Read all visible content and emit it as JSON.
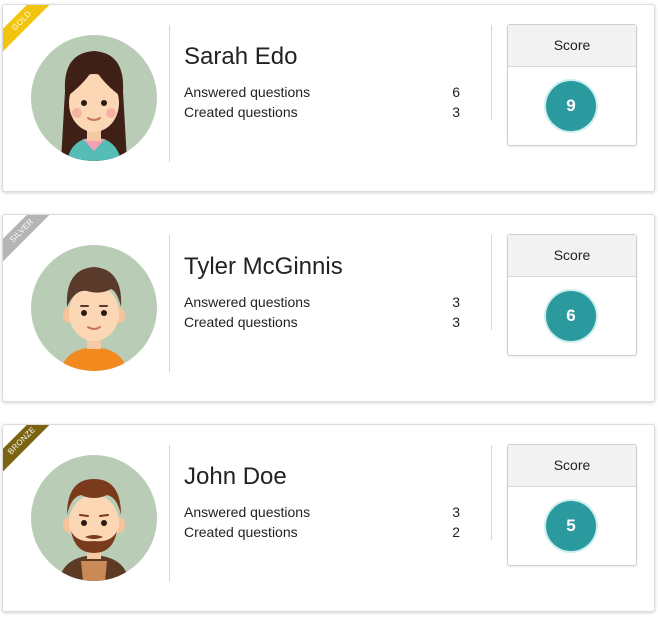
{
  "leaderboard": [
    {
      "rank_badge": "GOLD",
      "badge_color": "#f1c40f",
      "avatar_icon": "avatar-girl-icon",
      "name": "Sarah Edo",
      "answered_label": "Answered questions",
      "answered_value": "6",
      "created_label": "Created questions",
      "created_value": "3",
      "score_label": "Score",
      "score": "9"
    },
    {
      "rank_badge": "SILVER",
      "badge_color": "#b5b5b5",
      "avatar_icon": "avatar-boy-icon",
      "name": "Tyler McGinnis",
      "answered_label": "Answered questions",
      "answered_value": "3",
      "created_label": "Created questions",
      "created_value": "3",
      "score_label": "Score",
      "score": "6"
    },
    {
      "rank_badge": "BRONZE",
      "badge_color": "#7a6412",
      "avatar_icon": "avatar-bearded-man-icon",
      "name": "John Doe",
      "answered_label": "Answered questions",
      "answered_value": "3",
      "created_label": "Created questions",
      "created_value": "2",
      "score_label": "Score",
      "score": "5"
    }
  ],
  "colors": {
    "score_circle": "#2a9a9e",
    "avatar_bg": "#b9cdb6"
  }
}
